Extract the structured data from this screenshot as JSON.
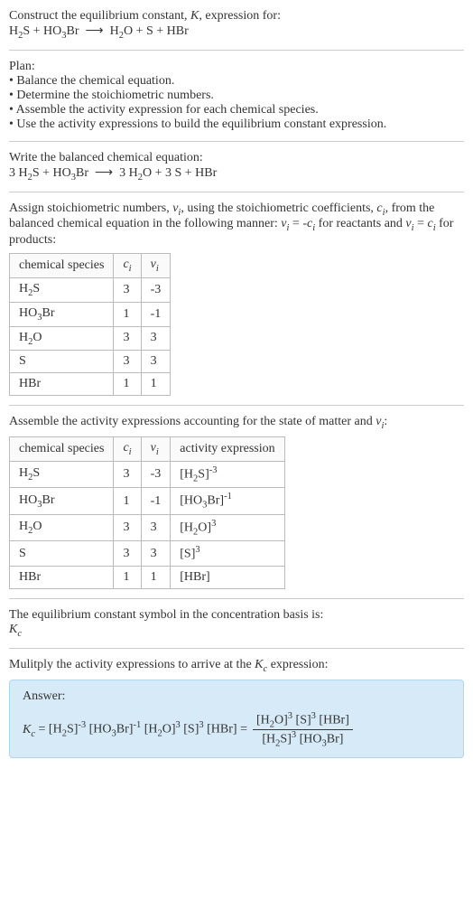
{
  "intro": {
    "line1": "Construct the equilibrium constant, K, expression for:",
    "reaction": "H₂S + HO₃Br  ⟶  H₂O + S + HBr"
  },
  "plan": {
    "heading": "Plan:",
    "b1": "• Balance the chemical equation.",
    "b2": "• Determine the stoichiometric numbers.",
    "b3": "• Assemble the activity expression for each chemical species.",
    "b4": "• Use the activity expressions to build the equilibrium constant expression."
  },
  "balanced": {
    "heading": "Write the balanced chemical equation:",
    "reaction": "3 H₂S + HO₃Br  ⟶  3 H₂O + 3 S + HBr"
  },
  "assign": {
    "text": "Assign stoichiometric numbers, νᵢ, using the stoichiometric coefficients, cᵢ, from the balanced chemical equation in the following manner: νᵢ = -cᵢ for reactants and νᵢ = cᵢ for products:"
  },
  "table1": {
    "h1": "chemical species",
    "h2": "cᵢ",
    "h3": "νᵢ",
    "rows": [
      {
        "sp": "H₂S",
        "c": "3",
        "v": "-3"
      },
      {
        "sp": "HO₃Br",
        "c": "1",
        "v": "-1"
      },
      {
        "sp": "H₂O",
        "c": "3",
        "v": "3"
      },
      {
        "sp": "S",
        "c": "3",
        "v": "3"
      },
      {
        "sp": "HBr",
        "c": "1",
        "v": "1"
      }
    ]
  },
  "assemble": {
    "text": "Assemble the activity expressions accounting for the state of matter and νᵢ:"
  },
  "table2": {
    "h1": "chemical species",
    "h2": "cᵢ",
    "h3": "νᵢ",
    "h4": "activity expression",
    "rows": [
      {
        "sp": "H₂S",
        "c": "3",
        "v": "-3",
        "a": "[H₂S]⁻³"
      },
      {
        "sp": "HO₃Br",
        "c": "1",
        "v": "-1",
        "a": "[HO₃Br]⁻¹"
      },
      {
        "sp": "H₂O",
        "c": "3",
        "v": "3",
        "a": "[H₂O]³"
      },
      {
        "sp": "S",
        "c": "3",
        "v": "3",
        "a": "[S]³"
      },
      {
        "sp": "HBr",
        "c": "1",
        "v": "1",
        "a": "[HBr]"
      }
    ]
  },
  "symbol": {
    "text": "The equilibrium constant symbol in the concentration basis is:",
    "k": "K",
    "c": "c"
  },
  "multiply": {
    "text": "Mulitply the activity expressions to arrive at the Kc expression:"
  },
  "answer": {
    "label": "Answer:",
    "lhs": "Kc = [H₂S]⁻³ [HO₃Br]⁻¹ [H₂O]³ [S]³ [HBr] =",
    "num": "[H₂O]³ [S]³ [HBr]",
    "den": "[H₂S]³ [HO₃Br]"
  }
}
